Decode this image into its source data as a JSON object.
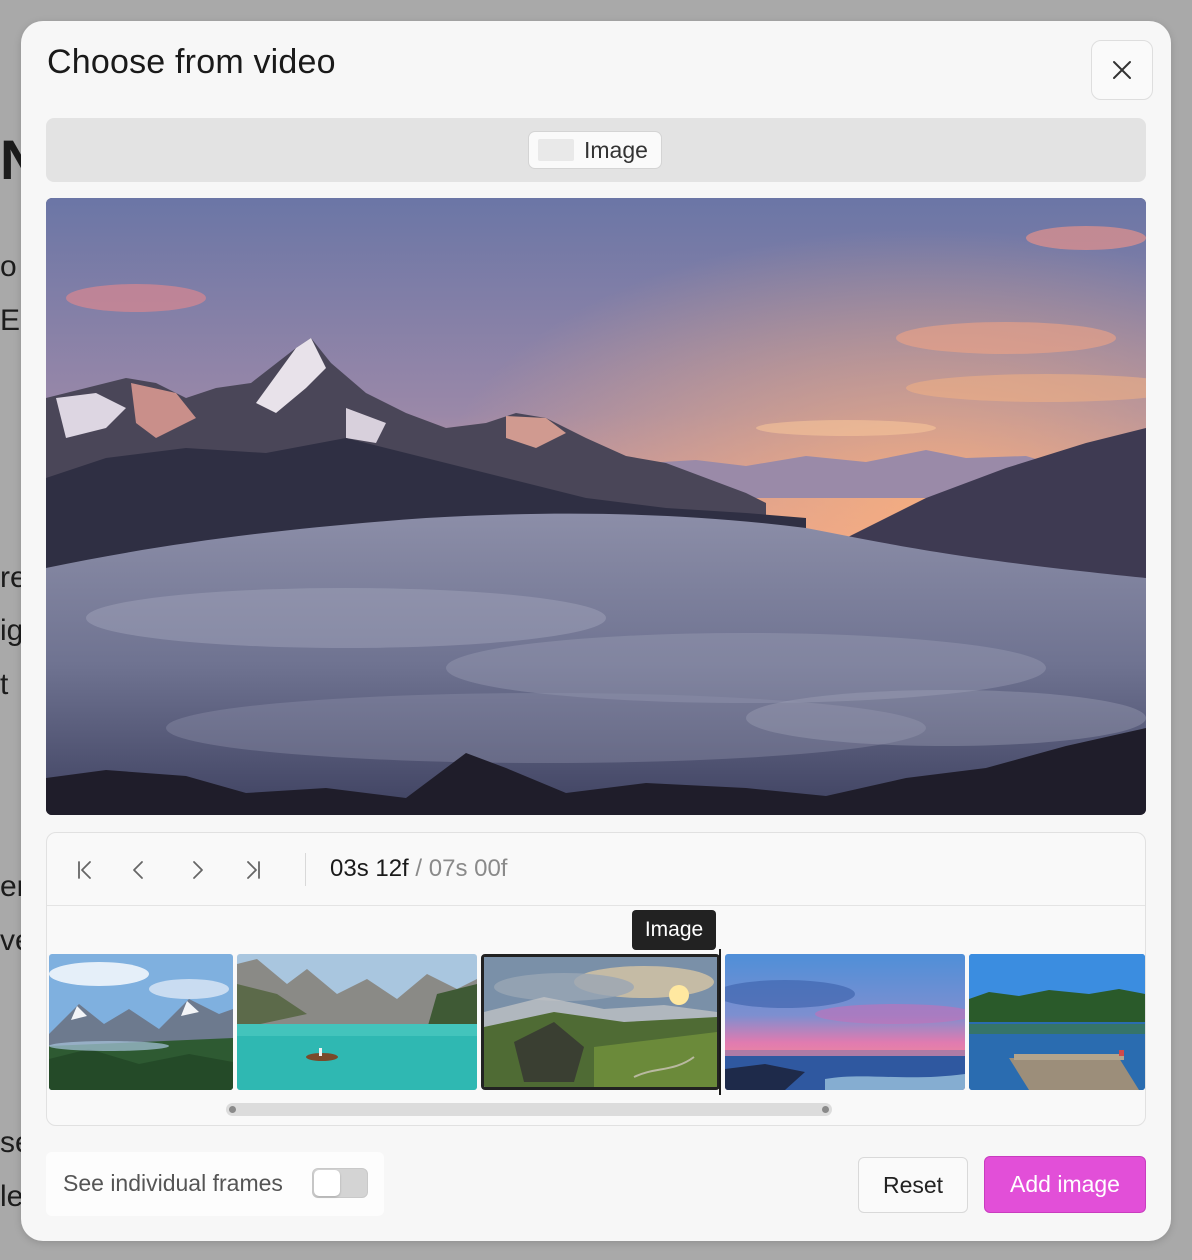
{
  "modal": {
    "title": "Choose from video",
    "close_icon": "close-icon"
  },
  "tab": {
    "label": "Image"
  },
  "player": {
    "current_time": "03s 12f",
    "separator": " / ",
    "total_time": "07s 00f",
    "icons": [
      "skip-to-start-icon",
      "previous-frame-icon",
      "next-frame-icon",
      "skip-to-end-icon"
    ]
  },
  "timeline": {
    "tooltip": "Image",
    "thumbnails": [
      {
        "scene": "mountain valley with pine forest"
      },
      {
        "scene": "turquoise lake with boat and cliffs"
      },
      {
        "scene": "green hills with sunset clouds",
        "selected": true
      },
      {
        "scene": "pink sunset over sea"
      },
      {
        "scene": "lake with wooden pier"
      }
    ]
  },
  "footer": {
    "toggle_label": "See individual frames",
    "toggle_on": false,
    "reset_label": "Reset",
    "add_label": "Add image"
  },
  "colors": {
    "accent": "#e24fd8",
    "backdrop": "#a9a9a9",
    "modal_bg": "#f7f7f7"
  },
  "background_page": {
    "fragments": [
      "Na",
      "o",
      "Ea",
      "re",
      "ig",
      "t",
      "er",
      "ve",
      "se",
      "le"
    ]
  }
}
